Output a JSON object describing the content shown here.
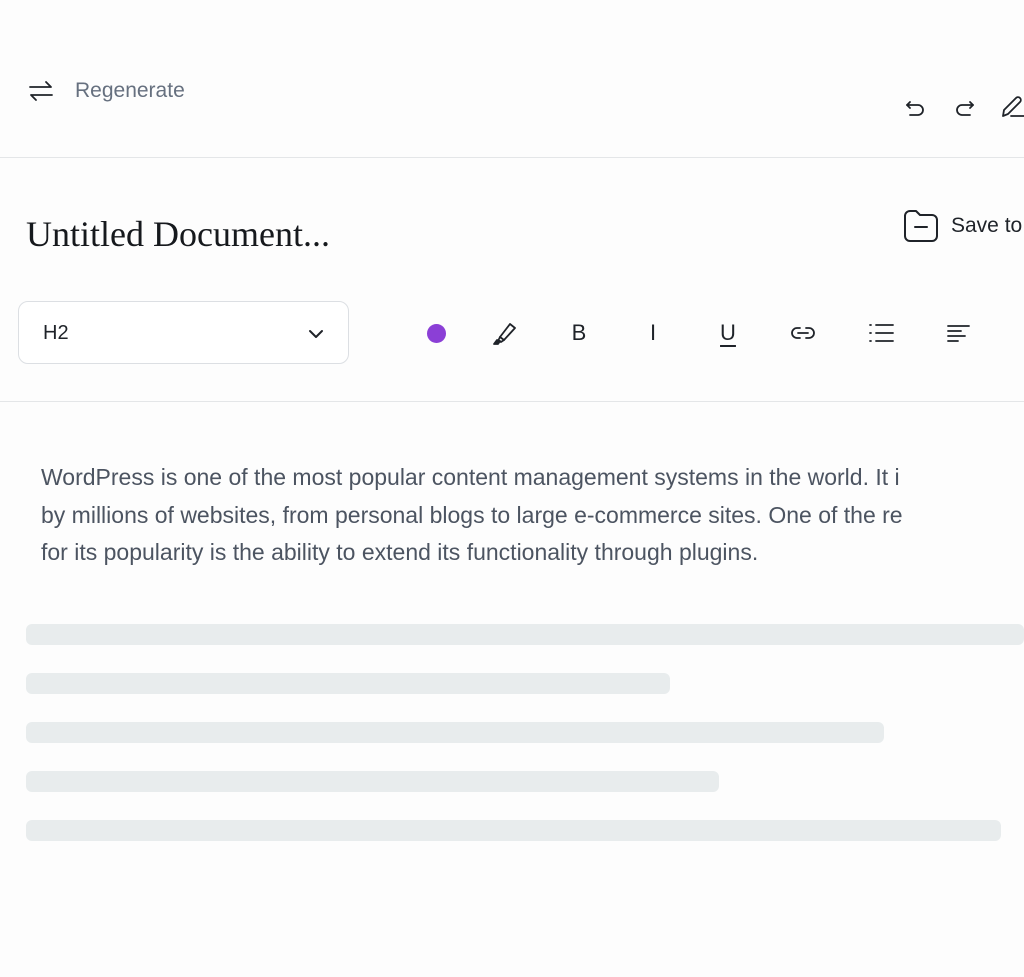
{
  "topbar": {
    "regenerate_label": "Regenerate",
    "actions": [
      "undo-icon",
      "redo-icon",
      "edit-icon"
    ]
  },
  "document": {
    "title": "Untitled Document...",
    "save_label": "Save to"
  },
  "toolbar": {
    "heading_value": "H2",
    "text_color": "#8b3fd6",
    "bold_label": "B",
    "italic_label": "I",
    "underline_label": "U",
    "icons": [
      "text-color-icon",
      "highlight-icon",
      "bold-icon",
      "italic-icon",
      "underline-icon",
      "link-icon",
      "list-icon",
      "align-left-icon"
    ]
  },
  "content": {
    "lines": [
      "WordPress is one of the most popular content management systems in the world. It i",
      "by millions of websites, from personal blogs to large e-commerce sites. One of the re",
      "for its popularity is the ability to extend its functionality through plugins."
    ]
  },
  "colors": {
    "accent": "#8b3fd6",
    "skeleton": "#e8eced",
    "body_text": "#4c5461"
  }
}
